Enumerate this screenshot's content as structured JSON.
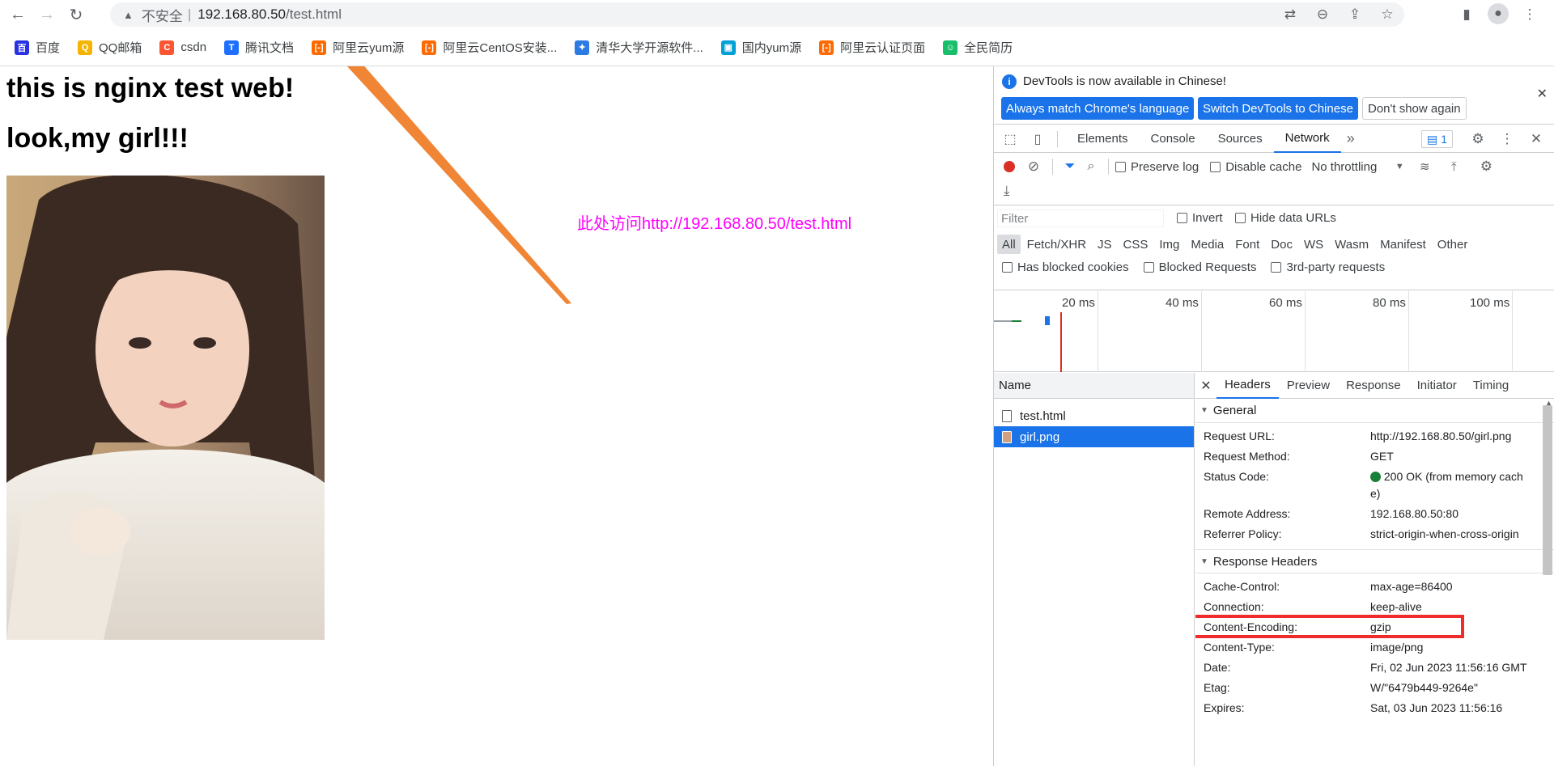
{
  "browser": {
    "insecure_label": "不安全",
    "url_host": "192.168.80.50",
    "url_path": "/test.html"
  },
  "bookmarks": [
    {
      "label": "百度",
      "color": "#2932e1"
    },
    {
      "label": "QQ邮箱",
      "color": "#f4b400"
    },
    {
      "label": "csdn",
      "color": "#fc5531"
    },
    {
      "label": "腾讯文档",
      "color": "#1e6fff"
    },
    {
      "label": "阿里云yum源",
      "color": "#ff6a00"
    },
    {
      "label": "阿里云CentOS安装...",
      "color": "#ff6a00"
    },
    {
      "label": "清华大学开源软件...",
      "color": "#2c7be5"
    },
    {
      "label": "国内yum源",
      "color": "#00a1d6"
    },
    {
      "label": "阿里云认证页面",
      "color": "#ff6a00"
    },
    {
      "label": "全民简历",
      "color": "#19be6b"
    }
  ],
  "page": {
    "heading1": "this is nginx test web!",
    "heading2": "look,my girl!!!",
    "annotation": "此处访问http://192.168.80.50/test.html",
    "annotation_color": "#ff00ff",
    "arrow_color": "#f08536"
  },
  "devtools": {
    "infobar": {
      "text": "DevTools is now available in Chinese!",
      "btn_match": "Always match Chrome's language",
      "btn_switch": "Switch DevTools to Chinese",
      "btn_dismiss": "Don't show again"
    },
    "tabs": [
      "Elements",
      "Console",
      "Sources",
      "Network"
    ],
    "active_tab": "Network",
    "issues_count": "1",
    "network": {
      "preserve_log": "Preserve log",
      "disable_cache": "Disable cache",
      "throttling": "No throttling",
      "filter_placeholder": "Filter",
      "invert": "Invert",
      "hide_data_urls": "Hide data URLs",
      "types": [
        "All",
        "Fetch/XHR",
        "JS",
        "CSS",
        "Img",
        "Media",
        "Font",
        "Doc",
        "WS",
        "Wasm",
        "Manifest",
        "Other"
      ],
      "has_blocked_cookies": "Has blocked cookies",
      "blocked_requests": "Blocked Requests",
      "third_party": "3rd-party requests",
      "timeline_ticks": [
        "20 ms",
        "40 ms",
        "60 ms",
        "80 ms",
        "100 ms"
      ],
      "name_header": "Name",
      "requests": [
        "test.html",
        "girl.png"
      ],
      "selected_request": "girl.png"
    },
    "details": {
      "tabs": [
        "Headers",
        "Preview",
        "Response",
        "Initiator",
        "Timing"
      ],
      "active_tab": "Headers",
      "general_title": "General",
      "general": [
        {
          "key": "Request URL:",
          "value": "http://192.168.80.50/girl.png"
        },
        {
          "key": "Request Method:",
          "value": "GET"
        },
        {
          "key": "Status Code:",
          "value": "200 OK (from memory cache)"
        },
        {
          "key": "Remote Address:",
          "value": "192.168.80.50:80"
        },
        {
          "key": "Referrer Policy:",
          "value": "strict-origin-when-cross-origin"
        }
      ],
      "response_title": "Response Headers",
      "response_headers": [
        {
          "key": "Cache-Control:",
          "value": "max-age=86400"
        },
        {
          "key": "Connection:",
          "value": "keep-alive"
        },
        {
          "key": "Content-Encoding:",
          "value": "gzip"
        },
        {
          "key": "Content-Type:",
          "value": "image/png"
        },
        {
          "key": "Date:",
          "value": "Fri, 02 Jun 2023 11:56:16 GMT"
        },
        {
          "key": "Etag:",
          "value": "W/\"6479b449-9264e\""
        },
        {
          "key": "Expires:",
          "value": "Sat, 03 Jun 2023 11:56:16"
        }
      ],
      "highlight_color": "#ee2c2c"
    }
  }
}
